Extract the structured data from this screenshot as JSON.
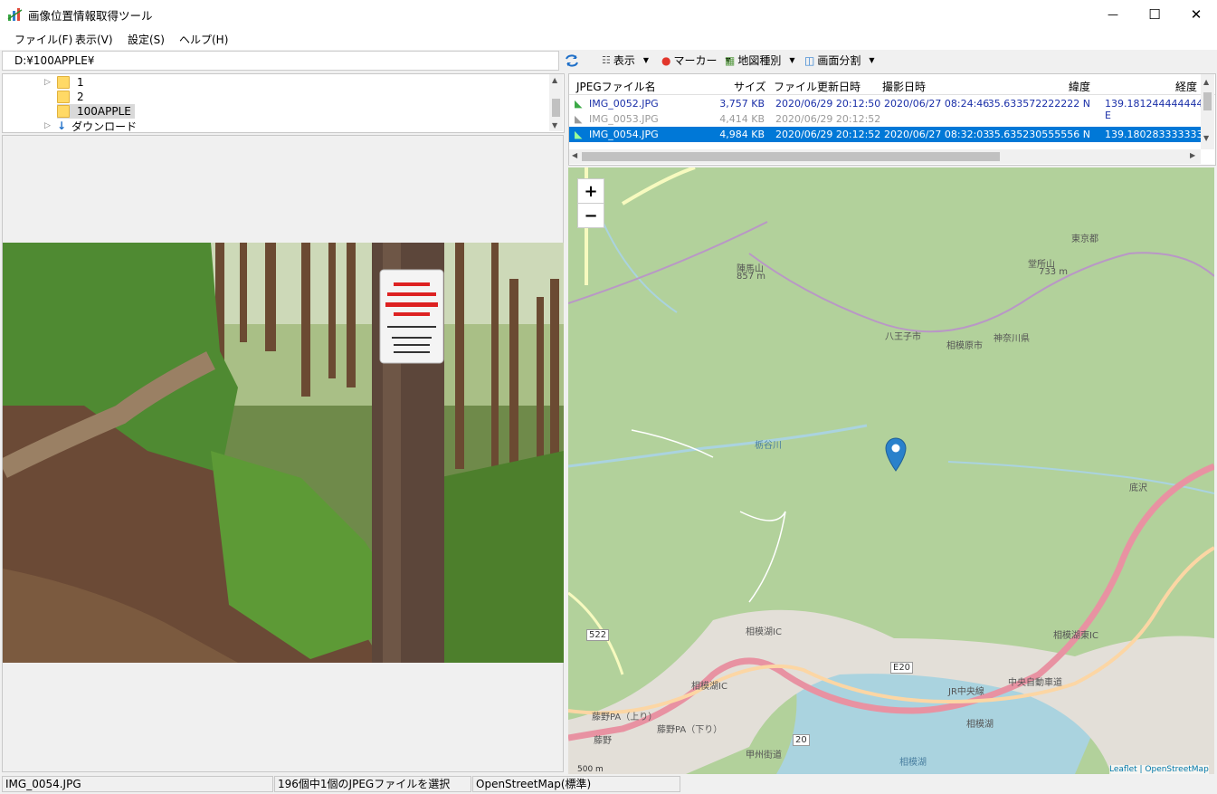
{
  "window": {
    "title": "画像位置情報取得ツール",
    "minimize_glyph": "—",
    "maximize_glyph": "☐",
    "close_glyph": "✕"
  },
  "menu": [
    "ファイル(F)",
    "表示(V)",
    "設定(S)",
    "ヘルプ(H)"
  ],
  "path": {
    "value": "D:¥100APPLE¥"
  },
  "toolbar": {
    "refresh_icon": "refresh-icon",
    "view_label": "表示",
    "marker_label": "マーカー",
    "map_type_label": "地図種別",
    "split_label": "画面分割"
  },
  "tree": {
    "items": [
      {
        "label": "1"
      },
      {
        "label": "2"
      },
      {
        "label": "100APPLE"
      },
      {
        "label": "ダウンロード"
      }
    ]
  },
  "filelist": {
    "headers": [
      "JPEGファイル名",
      "サイズ",
      "ファイル更新日時",
      "撮影日時",
      "緯度",
      "経度"
    ],
    "rows": [
      {
        "name": "IMG_0052.JPG",
        "size": "3,757 KB",
        "modified": "2020/06/29 20:12:50",
        "taken": "2020/06/27 08:24:46",
        "lat": "35.633572222222 N",
        "lon": "139.181244444444 E"
      },
      {
        "name": "IMG_0053.JPG",
        "size": "4,414 KB",
        "modified": "2020/06/29 20:12:52",
        "taken": "",
        "lat": "",
        "lon": ""
      },
      {
        "name": "IMG_0054.JPG",
        "size": "4,984 KB",
        "modified": "2020/06/29 20:12:52",
        "taken": "2020/06/27 08:32:03",
        "lat": "35.635230555556 N",
        "lon": "139.180283333333 E"
      }
    ]
  },
  "map": {
    "zoom_in": "+",
    "zoom_out": "−",
    "attribution": "Leaflet | OpenStreetMap",
    "scale": "500 m",
    "labels": {
      "jinba": "陣馬山",
      "jinba_h": "857 m",
      "domusho": "堂所山",
      "domusho_h": "733 m",
      "tokyo": "東京都",
      "hachioji": "八王子市",
      "sagamihara": "相模原市",
      "kanagawa": "神奈川県",
      "river_tochi": "栃谷川",
      "sokozawa": "底沢",
      "sagamiko_ic": "相模湖IC",
      "sagamiko_ic2": "相模湖IC",
      "sagamiko_higashi": "相模湖東IC",
      "e20": "E20",
      "r522": "522",
      "r20": "20",
      "fujino_pa": "藤野PA（上り）",
      "fujino_pa2": "藤野PA（下り）",
      "fujino": "藤野",
      "koshu": "甲州街道",
      "sagamiko": "相模湖",
      "sagamiko_lake": "相模湖",
      "chuo": "中央自動車道",
      "jr": "JR中央線"
    }
  },
  "status": {
    "file": "IMG_0054.JPG",
    "selection": "196個中1個のJPEGファイルを選択",
    "map_type": "OpenStreetMap(標準)"
  },
  "colors": {
    "selection": "#0078d7",
    "map_bg": "#b2d19b",
    "motorway": "#e892a2",
    "primary": "#fcd6a4",
    "water": "#aad3df",
    "marker": "#2a81cb"
  }
}
